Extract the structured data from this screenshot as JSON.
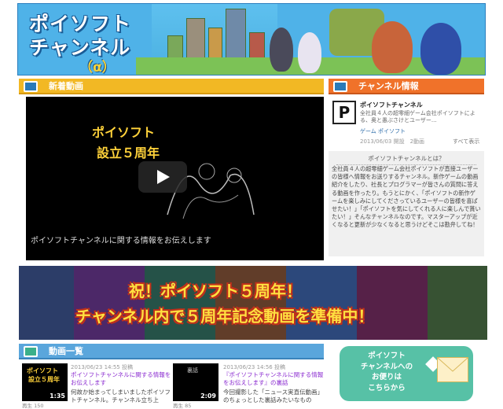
{
  "header": {
    "logo_line1": "ポイソフト",
    "logo_line2": "チャンネル",
    "logo_line3": "（α）"
  },
  "colors": {
    "accent_blue": "#4fb2e8",
    "accent_yellow": "#f2b824",
    "accent_teal": "#57c1a6"
  },
  "new_videos": {
    "title": "新着動画",
    "video_title_line1": "ポイソフト",
    "video_title_line2": "設立５周年",
    "caption": "ポイソフトチャンネルに関する情報をお伝えします"
  },
  "channel_info": {
    "title": "チャンネル情報",
    "logo_letter": "P",
    "name": "ポイソフトチャンネル",
    "desc": "全社員４人の超零細ゲーム会社ポイソフトによる、奥と愚ぶさけとユーザー...",
    "tag": "ゲーム ポイソフト",
    "opened": "2013/06/03 開設　2動画",
    "show_all": "すべて表示",
    "about_title": "ポイソフトチャンネルとは？",
    "about_text": "全社員４人の超零細ゲーム会社ポイソフトが直接ユーザーの皆様へ情報をお送りするチャンネル。新作ゲームの動画紹介をしたり、社長とプログラマーが皆さんの質問に答える動画を作ったり。もうとにかく、「ポイソフトの新作ゲームを楽しみにしてくださっているユーザーの皆様を喜ばせたい！」「ポイソフトを気にしてくれる人に楽しんで貰いたい！」そんなチャンネルなのです。マスターアップが近くなると更新が少なくなると思うけどそこは勘弁してね！"
  },
  "banner": {
    "line1": "祝！ポイソフト５周年！",
    "line2": "チャンネル内で５周年記念動画を準備中！"
  },
  "video_list": {
    "title": "動画一覧",
    "items": [
      {
        "date": "2013/06/23 14:55 投稿",
        "title": "ポイソフトチャンネルに関する情報をお伝えします",
        "desc": "何故か始まってしまいましたポイソフトチャンネル。チャンネル立ち上",
        "duration": "1:35",
        "views": "再生 150",
        "thumb_line1": "ポイソフト",
        "thumb_line2": "設立５周年"
      },
      {
        "date": "2013/06/23 14:56 投稿",
        "title": "『ポイソフトチャンネルに関する情報をお伝えします』の裏話",
        "desc": "今回撮影した「ニュース実直伝動画」のちょっとした裏話みたいなもの",
        "duration": "2:09",
        "views": "再生 85",
        "thumb_line1": "裏話"
      }
    ]
  },
  "contact": {
    "line1": "ポイソフト",
    "line2": "チャンネルへの",
    "line3": "お便りは",
    "line4": "こちらから"
  }
}
